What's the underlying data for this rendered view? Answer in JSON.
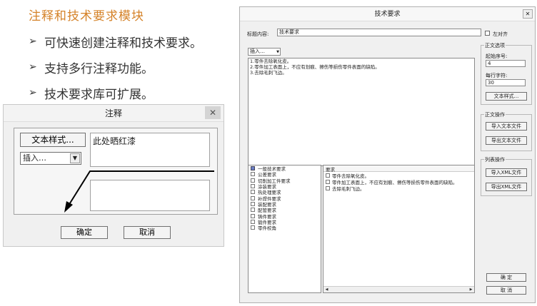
{
  "slide": {
    "title": "注释和技术要求模块",
    "bullet_marker": "➢",
    "bullets": [
      "可快速创建注释和技术要求。",
      "支持多行注释功能。",
      "技术要求库可扩展。"
    ],
    "title_color": "#d5832a"
  },
  "note_dialog": {
    "title": "注释",
    "close": "✕",
    "text_style_button": "文本样式...",
    "insert_select": "插入…",
    "text_value": "此处晒红漆",
    "ok": "确定",
    "cancel": "取消"
  },
  "tech_dialog": {
    "title": "技术要求",
    "close": "✕",
    "title_label": "标题内容:",
    "title_value": "技术要求",
    "left_align_label": "左对齐",
    "insert_select": "插入…",
    "body_lines": [
      "1.零件去除氧化皮。",
      "2.零件加工表面上，不应有划痕、擦伤等损伤零件表面的缺陷。",
      "3.去除毛刺飞边。"
    ],
    "text_options": {
      "group_label": "正文选项",
      "start_no_label": "起始序号:",
      "start_no_value": "4",
      "chars_label": "每行字符:",
      "chars_value": "30",
      "text_style_button": "文本样式..."
    },
    "text_ops": {
      "group_label": "正文操作",
      "import_button": "导入文本文件",
      "export_button": "导出文本文件"
    },
    "list_ops": {
      "group_label": "列表操作",
      "import_button": "导入XML文件",
      "export_button": "导出XML文件"
    },
    "categories": [
      "一般技术要求",
      "公差要求",
      "切削加工件要求",
      "涂装要求",
      "热处理要求",
      "补焊件要求",
      "装配要求",
      "配管要求",
      "铸件要求",
      "锻件要求",
      "零件校角"
    ],
    "requirements_header": "要求",
    "requirements": [
      "零件去除氧化皮。",
      "零件加工表面上，不应有划痕、擦伤等损伤零件表面的缺陷。",
      "去除毛刺飞边。"
    ],
    "ok": "确 定",
    "cancel": "取 消"
  }
}
